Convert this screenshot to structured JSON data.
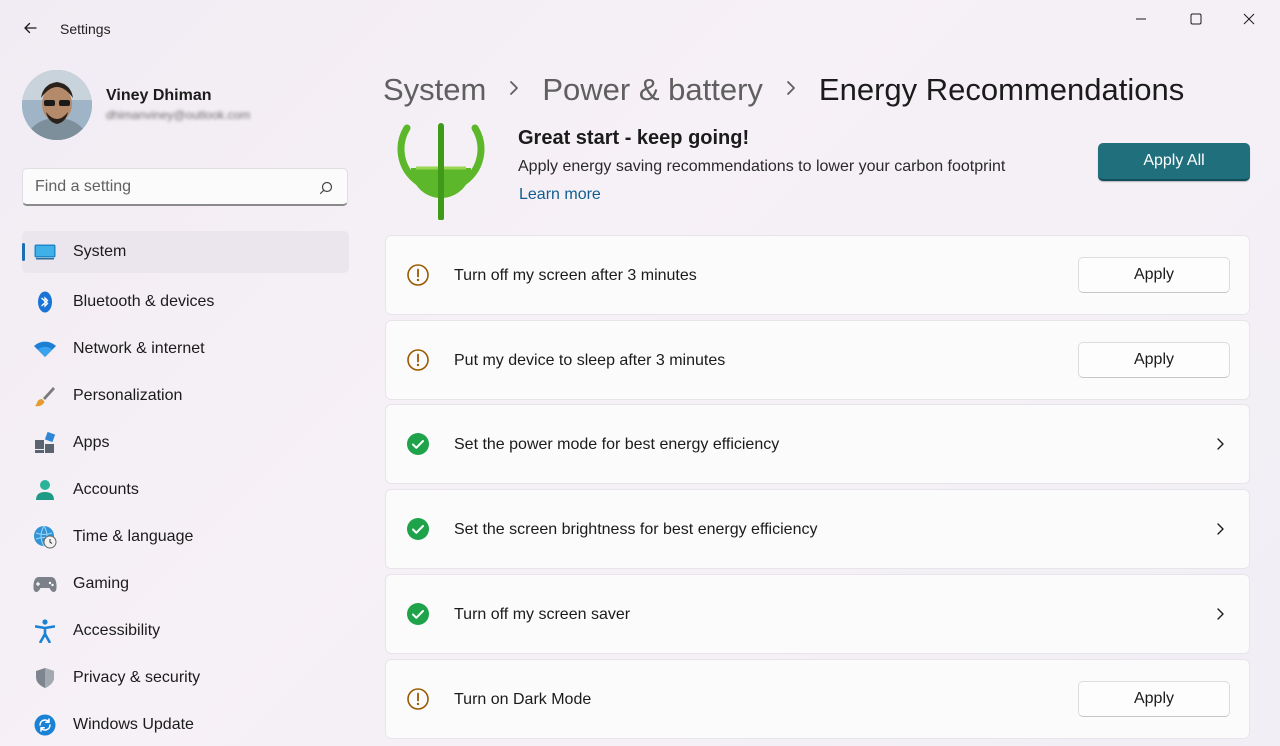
{
  "window": {
    "title": "Settings"
  },
  "profile": {
    "name": "Viney Dhiman",
    "email": "dhimanviney@outlook.com"
  },
  "search": {
    "placeholder": "Find a setting"
  },
  "sidebar": {
    "items": [
      {
        "label": "System",
        "icon": "system-icon",
        "active": true
      },
      {
        "label": "Bluetooth & devices",
        "icon": "bluetooth-icon"
      },
      {
        "label": "Network & internet",
        "icon": "wifi-icon"
      },
      {
        "label": "Personalization",
        "icon": "brush-icon"
      },
      {
        "label": "Apps",
        "icon": "apps-icon"
      },
      {
        "label": "Accounts",
        "icon": "account-icon"
      },
      {
        "label": "Time & language",
        "icon": "globe-clock-icon"
      },
      {
        "label": "Gaming",
        "icon": "gamepad-icon"
      },
      {
        "label": "Accessibility",
        "icon": "accessibility-icon"
      },
      {
        "label": "Privacy & security",
        "icon": "shield-icon"
      },
      {
        "label": "Windows Update",
        "icon": "update-icon"
      }
    ]
  },
  "breadcrumb": {
    "items": [
      "System",
      "Power & battery"
    ],
    "current": "Energy Recommendations"
  },
  "hero": {
    "title": "Great start - keep going!",
    "description": "Apply energy saving recommendations to lower your carbon footprint",
    "link": "Learn more",
    "apply_all_label": "Apply All"
  },
  "recommendations": [
    {
      "label": "Turn off my screen after 3 minutes",
      "status": "warning",
      "action": "Apply"
    },
    {
      "label": "Put my device to sleep after 3 minutes",
      "status": "warning",
      "action": "Apply"
    },
    {
      "label": "Set the power mode for best energy efficiency",
      "status": "done"
    },
    {
      "label": "Set the screen brightness for best energy efficiency",
      "status": "done"
    },
    {
      "label": "Turn off my screen saver",
      "status": "done"
    },
    {
      "label": "Turn on Dark Mode",
      "status": "warning",
      "action": "Apply"
    }
  ],
  "colors": {
    "accent": "#1f6f7d",
    "link": "#0f5e8f",
    "warning": "#9a5a00",
    "success": "#1fa34a"
  }
}
